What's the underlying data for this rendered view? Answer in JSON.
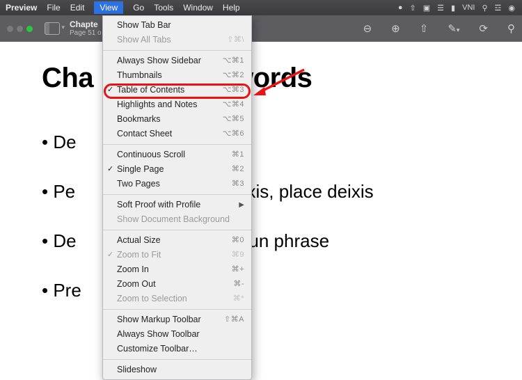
{
  "menubar": {
    "app": "Preview",
    "items": [
      "File",
      "Edit",
      "View",
      "Go",
      "Tools",
      "Window",
      "Help"
    ],
    "active_index": 2,
    "status_right": [
      "VNI"
    ]
  },
  "toolbar": {
    "title": "Chapte",
    "subtitle": "Page 51 o"
  },
  "document": {
    "heading_left": "Cha",
    "heading_right": "y words",
    "bullet_left": [
      "De",
      "Pe",
      "De",
      "Pre"
    ],
    "bullet_right": [
      "",
      "e deixis, place deixis",
      "te noun phrase",
      ""
    ]
  },
  "dropdown": {
    "groups": [
      [
        {
          "label": "Show Tab Bar",
          "shortcut": "",
          "disabled": false
        },
        {
          "label": "Show All Tabs",
          "shortcut": "⇧⌘\\",
          "disabled": true
        }
      ],
      [
        {
          "label": "Always Show Sidebar",
          "shortcut": "⌥⌘1",
          "disabled": false
        },
        {
          "label": "Thumbnails",
          "shortcut": "⌥⌘2",
          "disabled": false,
          "highlighted": true
        },
        {
          "label": "Table of Contents",
          "shortcut": "⌥⌘3",
          "disabled": false,
          "checked": true
        },
        {
          "label": "Highlights and Notes",
          "shortcut": "⌥⌘4",
          "disabled": false
        },
        {
          "label": "Bookmarks",
          "shortcut": "⌥⌘5",
          "disabled": false
        },
        {
          "label": "Contact Sheet",
          "shortcut": "⌥⌘6",
          "disabled": false
        }
      ],
      [
        {
          "label": "Continuous Scroll",
          "shortcut": "⌘1",
          "disabled": false
        },
        {
          "label": "Single Page",
          "shortcut": "⌘2",
          "disabled": false,
          "checked": true
        },
        {
          "label": "Two Pages",
          "shortcut": "⌘3",
          "disabled": false
        }
      ],
      [
        {
          "label": "Soft Proof with Profile",
          "shortcut": "",
          "disabled": false,
          "submenu": true
        },
        {
          "label": "Show Document Background",
          "shortcut": "",
          "disabled": true
        }
      ],
      [
        {
          "label": "Actual Size",
          "shortcut": "⌘0",
          "disabled": false
        },
        {
          "label": "Zoom to Fit",
          "shortcut": "⌘9",
          "disabled": true,
          "checked": true
        },
        {
          "label": "Zoom In",
          "shortcut": "⌘+",
          "disabled": false
        },
        {
          "label": "Zoom Out",
          "shortcut": "⌘-",
          "disabled": false
        },
        {
          "label": "Zoom to Selection",
          "shortcut": "⌘*",
          "disabled": true
        }
      ],
      [
        {
          "label": "Show Markup Toolbar",
          "shortcut": "⇧⌘A",
          "disabled": false
        },
        {
          "label": "Always Show Toolbar",
          "shortcut": "",
          "disabled": false
        },
        {
          "label": "Customize Toolbar…",
          "shortcut": "",
          "disabled": false
        }
      ],
      [
        {
          "label": "Slideshow",
          "shortcut": "",
          "disabled": false
        }
      ]
    ]
  }
}
